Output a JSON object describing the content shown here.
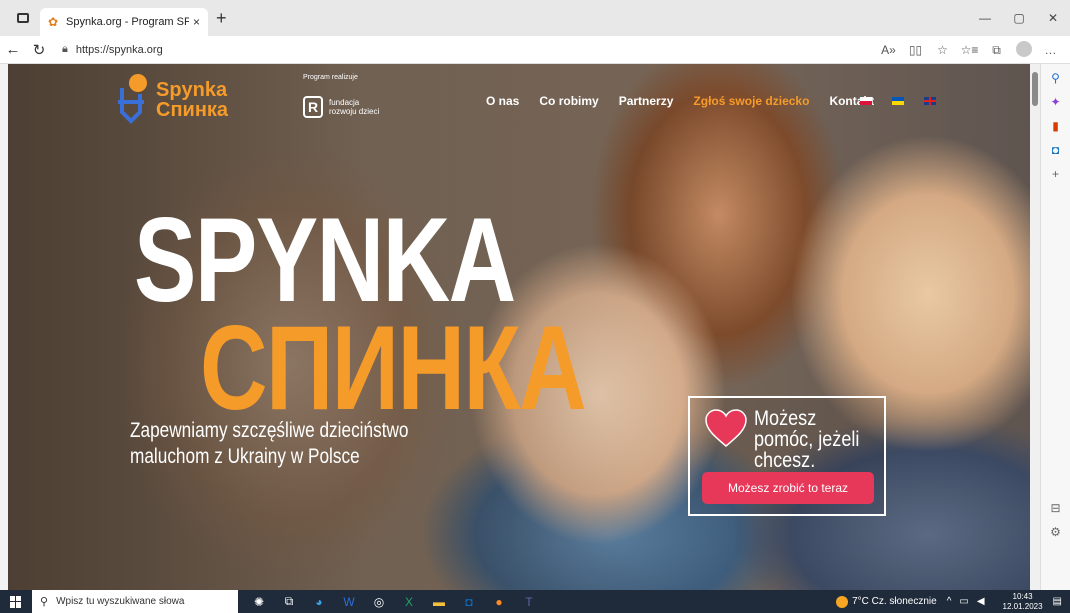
{
  "browser": {
    "tab_title": "Spynka.org - Program SPYNKA w",
    "url": "https://spynka.org",
    "new_tab": "+",
    "close": "×"
  },
  "site": {
    "logo_line1": "Spynka",
    "logo_line2": "Спинка",
    "partner_label": "Program realizuje",
    "partner_name_line1": "fundacja",
    "partner_name_line2": "rozwoju dzieci",
    "nav": [
      "O nas",
      "Co robimy",
      "Partnerzy",
      "Zgłoś swoje dziecko",
      "Kontakt"
    ],
    "headline1": "SPYNKA",
    "headline2": "СПИНКА",
    "tagline": "Zapewniamy szczęśliwe dzieciństwo maluchom z Ukrainy w Polsce",
    "help_text": "Możesz pomóc, jeżeli chcesz.",
    "help_button": "Możesz zrobić to teraz",
    "colors": {
      "accent": "#f59b2a",
      "button": "#e8385a",
      "heart": "#e8385a"
    }
  },
  "taskbar": {
    "search_placeholder": "Wpisz tu wyszukiwane słowa",
    "weather": "7°C  Cz. słonecznie",
    "time": "10:43",
    "date": "12.01.2023"
  }
}
